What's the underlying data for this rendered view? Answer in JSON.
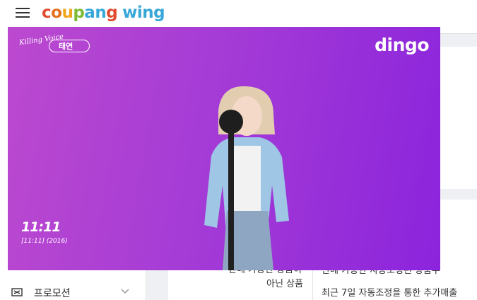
{
  "header": {
    "logo_primary": "coupang",
    "logo_secondary": "wing",
    "logo_letter_colors": [
      "#e04a2e",
      "#e36f1c",
      "#f0a51c",
      "#7dbb34",
      "#36a7d8",
      "#36a7d8",
      "#e04a2e"
    ],
    "wing_color": "#36a7d8"
  },
  "sidebar": {
    "items": [
      {
        "label": "프로모션",
        "icon": "promotion-icon",
        "expand_icon": "chevron-down-icon"
      }
    ]
  },
  "table": {
    "cells": [
      "판매 가능한 상품이",
      "아닌 상품",
      "판매 가능한 자동조정된 상품수",
      "최근 7일 자동조정을 통한 추가매출"
    ]
  },
  "video": {
    "background_colors": [
      "#bc49cf",
      "#8b24dc"
    ],
    "series_badge_script": "Killing Voice",
    "series_badge_name": "태연",
    "brand_logo": "dingo",
    "song_title": "11:11",
    "song_subtitle": "[11:11] (2016)"
  }
}
